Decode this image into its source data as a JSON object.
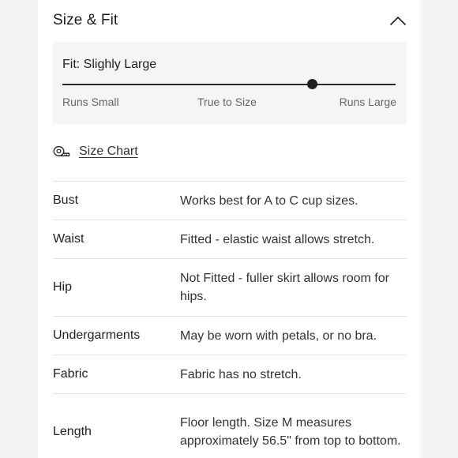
{
  "header": {
    "title": "Size & Fit"
  },
  "fit": {
    "label": "Fit: Slighly Large",
    "position": 0.75,
    "scale": {
      "left": "Runs Small",
      "middle": "True to Size",
      "right": "Runs Large"
    }
  },
  "size_chart": {
    "label": "Size Chart"
  },
  "details": [
    {
      "key": "Bust",
      "value": "Works best for A to C cup sizes."
    },
    {
      "key": "Waist",
      "value": "Fitted - elastic waist allows stretch."
    },
    {
      "key": "Hip",
      "value": "Not Fitted - fuller skirt allows room for hips."
    },
    {
      "key": "Undergarments",
      "value": "May be worn with petals, or no bra."
    },
    {
      "key": "Fabric",
      "value": "Fabric has no stretch."
    },
    {
      "key": "Length",
      "value": "Floor length. Size M measures approximately 56.5\" from top to bottom."
    }
  ]
}
